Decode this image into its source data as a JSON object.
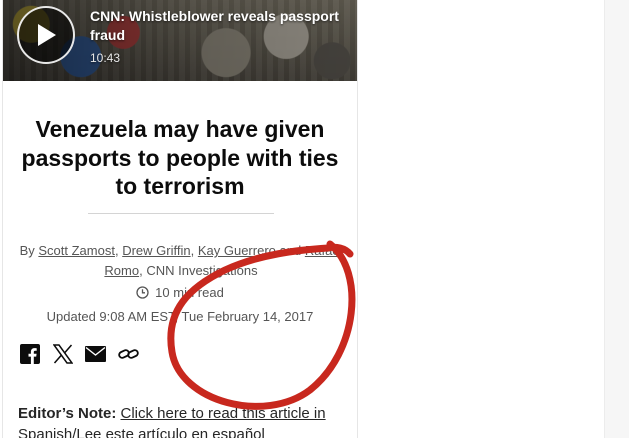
{
  "video": {
    "title": "CNN: Whistleblower reveals passport fraud",
    "duration": "10:43"
  },
  "article": {
    "headline": "Venezuela may have given passports to people with ties to terrorism",
    "byline_prefix": "By",
    "authors": [
      "Scott Zamost",
      "Drew Griffin",
      "Kay Guerrero",
      "Rafael Romo"
    ],
    "and_word": "and",
    "separator": ",",
    "org": "CNN Investigations",
    "read_time": "10 min read",
    "updated": "Updated 9:08 AM EST, Tue February 14, 2017"
  },
  "share": {
    "icons": [
      "facebook-icon",
      "x-icon",
      "email-icon",
      "link-icon"
    ]
  },
  "editors_note": {
    "label": "Editor’s Note:",
    "link_text": "Click here to read this article in Spanish/Lee este artículo en español"
  },
  "annotation_color": "#c8281e"
}
